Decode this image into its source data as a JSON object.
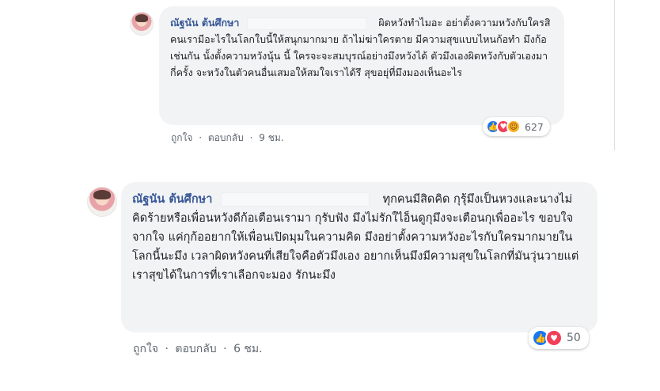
{
  "comments": [
    {
      "author": "ณัฐนัน ต้นศึกษา",
      "text": "ผิดหวังทำไมอะ อย่าตั้งความหวังกับใครสิ คนเรามีอะไรในโลกใบนี้ให้สนุกมากมาย ถ้าไม่ฆ่าใครตาย มีความสุขแบบไหนก้อทำ มึงก้อเช่นกัน นั้งตั้งความหวังนุ้น นี้ ใครจะจะสมบุรณ์อย่างมึงหวังได้ ตัวมึงเองผิดหวังกับตัวเองมากี่ครั้ง จะหวังในตัวคนอื่นเสมอให้สมใจเราได้รึ สุขอยุ่ที่มึงมองเห็นอะไร",
      "like_label": "ถูกใจ",
      "reply_label": "ตอบกลับ",
      "time": "9 ชม.",
      "reaction_icons": [
        "like-icon",
        "love-icon",
        "haha-icon"
      ],
      "reaction_count": "627"
    },
    {
      "author": "ณัฐนัน ต้นศึกษา",
      "text": "ทุกคนมีสิดคิด กุรุ้มึงเป็นหวงและนางไม่คิดร้ายหรือเพื่อนหวังดีก้อเตือนเรามา กุรับฟัง มึงไม่รักใไอ็นดูกุมึงจะเตือนกุเพื่ออะไร ขอบใจจากใจ แค่กุก้ออยากให้เพื่อนเปิดมุมในความคิด มึงอย่าตั้งความหวังอะไรกับใครมากมายในโลกนี้นะมึง เวลาผิดหวังคนที่เสียใจคือตัวมึงเอง อยากเห็นมึงมีความสุขในโลกที่มันวุ่นวายแต่เราสุขได้ในการที่เราเลือกจะมอง รักนะมึง",
      "like_label": "ถูกใจ",
      "reply_label": "ตอบกลับ",
      "time": "6 ชม.",
      "reaction_icons": [
        "like-icon",
        "love-icon"
      ],
      "reaction_count": "50"
    }
  ],
  "separator": "·",
  "colors": {
    "author": "#385898",
    "bubble": "#f2f3f5",
    "meta": "#606770",
    "like": "#1877f2",
    "love": "#f33e58",
    "haha": "#f7b125"
  }
}
